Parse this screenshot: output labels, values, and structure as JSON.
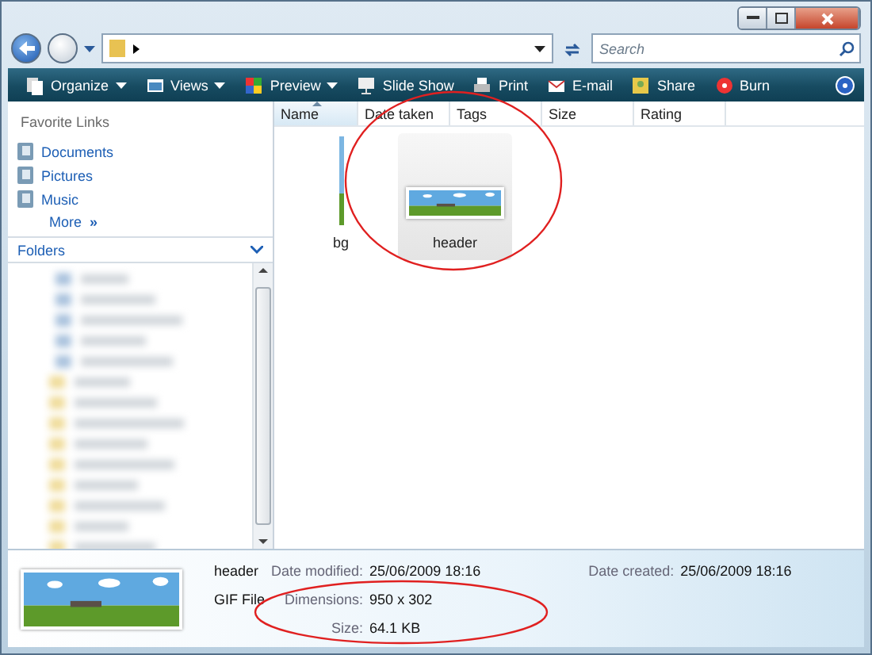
{
  "address": {
    "search_placeholder": "Search"
  },
  "toolbar": [
    {
      "label": "Organize",
      "dropdown": true
    },
    {
      "label": "Views",
      "dropdown": true
    },
    {
      "label": "Preview",
      "dropdown": true
    },
    {
      "label": "Slide Show",
      "dropdown": false
    },
    {
      "label": "Print",
      "dropdown": false
    },
    {
      "label": "E-mail",
      "dropdown": false
    },
    {
      "label": "Share",
      "dropdown": false
    },
    {
      "label": "Burn",
      "dropdown": false
    }
  ],
  "favorite_links": {
    "title": "Favorite Links",
    "items": [
      "Documents",
      "Pictures",
      "Music"
    ],
    "more": "More",
    "more_glyph": "»"
  },
  "folders": {
    "title": "Folders"
  },
  "columns": [
    {
      "label": "Name",
      "sorted": true
    },
    {
      "label": "Date taken",
      "sorted": false
    },
    {
      "label": "Tags",
      "sorted": false
    },
    {
      "label": "Size",
      "sorted": false
    },
    {
      "label": "Rating",
      "sorted": false
    }
  ],
  "files": [
    {
      "name": "bg",
      "kind": "strip",
      "selected": false
    },
    {
      "name": "header",
      "kind": "landscape",
      "selected": true
    }
  ],
  "details": {
    "name": "header",
    "type": "GIF File",
    "fields": [
      {
        "label": "Date modified:",
        "value": "25/06/2009 18:16"
      },
      {
        "label": "Date created:",
        "value": "25/06/2009 18:16"
      },
      {
        "label": "Dimensions:",
        "value": "950 x 302"
      },
      {
        "label": "Size:",
        "value": "64.1 KB"
      }
    ]
  }
}
